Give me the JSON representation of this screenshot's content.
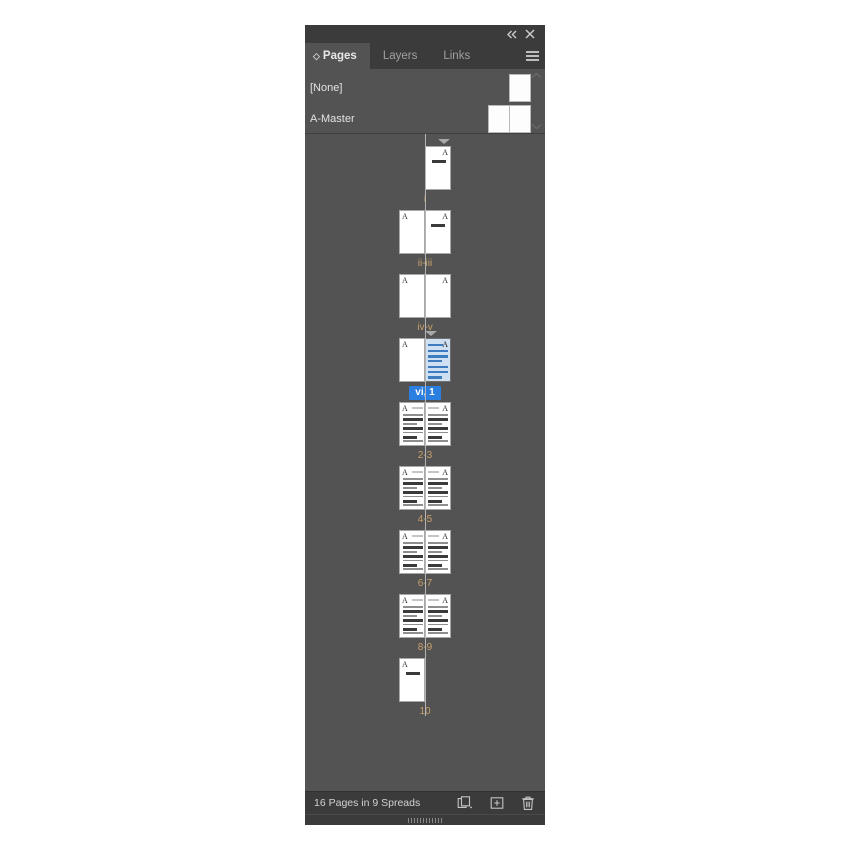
{
  "panel": {
    "titlebar": {
      "collapse_icon": "double-chevron-left-icon",
      "close_icon": "close-icon"
    },
    "tabs": [
      {
        "label": "Pages",
        "active": true
      },
      {
        "label": "Layers",
        "active": false
      },
      {
        "label": "Links",
        "active": false
      }
    ],
    "menu_icon": "hamburger-menu-icon"
  },
  "masters": {
    "items": [
      {
        "name": "[None]",
        "pages": 1
      },
      {
        "name": "A-Master",
        "pages": 2
      }
    ]
  },
  "pages": {
    "spreads": [
      {
        "label": "i",
        "selected": false,
        "section_marker": true,
        "layout": "right-only",
        "pages": [
          {
            "master": "A",
            "master_side": "right",
            "content": "title",
            "selected": false
          }
        ]
      },
      {
        "label": "ii-iii",
        "selected": false,
        "section_marker": false,
        "layout": "spread",
        "pages": [
          {
            "master": "A",
            "master_side": "left",
            "content": "blank",
            "selected": false
          },
          {
            "master": "A",
            "master_side": "right",
            "content": "title",
            "selected": false
          }
        ]
      },
      {
        "label": "iv-v",
        "selected": false,
        "section_marker": false,
        "layout": "spread",
        "pages": [
          {
            "master": "A",
            "master_side": "left",
            "content": "blank",
            "selected": false
          },
          {
            "master": "A",
            "master_side": "right",
            "content": "blank",
            "selected": false
          }
        ]
      },
      {
        "label": "vi, 1",
        "selected": true,
        "section_marker": true,
        "layout": "spread",
        "pages": [
          {
            "master": "A",
            "master_side": "left",
            "content": "blank",
            "selected": false
          },
          {
            "master": "A",
            "master_side": "right",
            "content": "text-selected",
            "selected": true
          }
        ]
      },
      {
        "label": "2-3",
        "selected": false,
        "section_marker": false,
        "layout": "spread",
        "pages": [
          {
            "master": "A",
            "master_side": "left",
            "content": "text",
            "selected": false
          },
          {
            "master": "A",
            "master_side": "right",
            "content": "text",
            "selected": false
          }
        ]
      },
      {
        "label": "4-5",
        "selected": false,
        "section_marker": false,
        "layout": "spread",
        "pages": [
          {
            "master": "A",
            "master_side": "left",
            "content": "text",
            "selected": false
          },
          {
            "master": "A",
            "master_side": "right",
            "content": "text",
            "selected": false
          }
        ]
      },
      {
        "label": "6-7",
        "selected": false,
        "section_marker": false,
        "layout": "spread",
        "pages": [
          {
            "master": "A",
            "master_side": "left",
            "content": "text",
            "selected": false
          },
          {
            "master": "A",
            "master_side": "right",
            "content": "text",
            "selected": false
          }
        ]
      },
      {
        "label": "8-9",
        "selected": false,
        "section_marker": false,
        "layout": "spread",
        "pages": [
          {
            "master": "A",
            "master_side": "left",
            "content": "text",
            "selected": false
          },
          {
            "master": "A",
            "master_side": "right",
            "content": "text",
            "selected": false
          }
        ]
      },
      {
        "label": "10",
        "selected": false,
        "section_marker": false,
        "layout": "left-only",
        "pages": [
          {
            "master": "A",
            "master_side": "left",
            "content": "title",
            "selected": false
          }
        ]
      }
    ]
  },
  "status": {
    "text": "16 Pages in 9 Spreads",
    "icons": [
      {
        "name": "new-spread-icon"
      },
      {
        "name": "new-page-icon"
      },
      {
        "name": "delete-page-icon"
      }
    ]
  },
  "colors": {
    "panel_bg": "#535353",
    "chrome_bg": "#3b3b3b",
    "page_label": "#c8a06a",
    "selection_blue": "#2b7fe0",
    "content_blue": "#3f7cbf"
  }
}
